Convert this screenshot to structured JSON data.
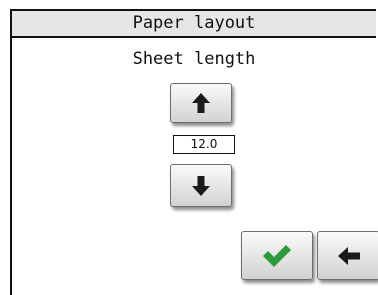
{
  "window": {
    "title": "Paper layout"
  },
  "main": {
    "heading": "Sheet length",
    "value": "12.0",
    "buttons": {
      "increase_icon": "arrow-up-icon",
      "decrease_icon": "arrow-down-icon",
      "confirm_icon": "checkmark-icon",
      "back_icon": "arrow-left-icon"
    }
  },
  "colors": {
    "confirm": "#2f9a3c",
    "icon": "#1a1a1a",
    "title_bar": "#e6e6e6"
  }
}
